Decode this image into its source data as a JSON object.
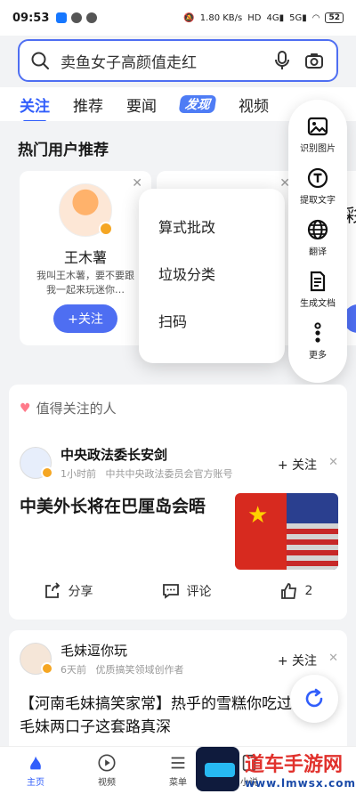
{
  "status_bar": {
    "time": "09:53",
    "net_speed": "1.80 KB/s",
    "battery": "52"
  },
  "search": {
    "placeholder": "卖鱼女子高颜值走红"
  },
  "tabs": [
    {
      "label": "关注",
      "active": true
    },
    {
      "label": "推荐"
    },
    {
      "label": "要闻"
    },
    {
      "label": "发现"
    },
    {
      "label": "视频"
    }
  ],
  "hot_users": {
    "title": "热门用户推荐",
    "cards": [
      {
        "name": "王木薯",
        "desc": "我叫王木薯，要不要跟我一起来玩迷你…",
        "follow": "+关注"
      }
    ],
    "partial_char": "彩"
  },
  "popup_menu": {
    "items": [
      "算式批改",
      "垃圾分类",
      "扫码"
    ]
  },
  "side_tools": [
    {
      "label": "识别图片",
      "icon": "image-icon"
    },
    {
      "label": "提取文字",
      "icon": "text-t-icon"
    },
    {
      "label": "翻译",
      "icon": "globe-icon"
    },
    {
      "label": "生成文档",
      "icon": "document-icon"
    },
    {
      "label": "更多",
      "icon": "more-dots-icon"
    }
  ],
  "feed": {
    "section_title": "值得关注的人",
    "post1": {
      "author": "中央政法委长安剑",
      "time": "1小时前",
      "source": "中共中央政法委员会官方账号",
      "follow": "+ 关注",
      "title": "中美外长将在巴厘岛会晤",
      "share": "分享",
      "comment": "评论",
      "likes": "2"
    },
    "post2": {
      "author": "毛妹逗你玩",
      "time": "6天前",
      "source": "优质搞笑领域创作者",
      "follow": "+ 关注",
      "title": "【河南毛妹搞笑家常】热乎的雪糕你吃过吗？毛妹两口子这套路真深"
    }
  },
  "bottom_nav": [
    {
      "label": "主页",
      "active": true
    },
    {
      "label": "视频"
    },
    {
      "label": "菜单"
    },
    {
      "label": "小说"
    }
  ],
  "watermark": {
    "text": "道车手游网",
    "url_text": "www.lmwsx.com"
  }
}
